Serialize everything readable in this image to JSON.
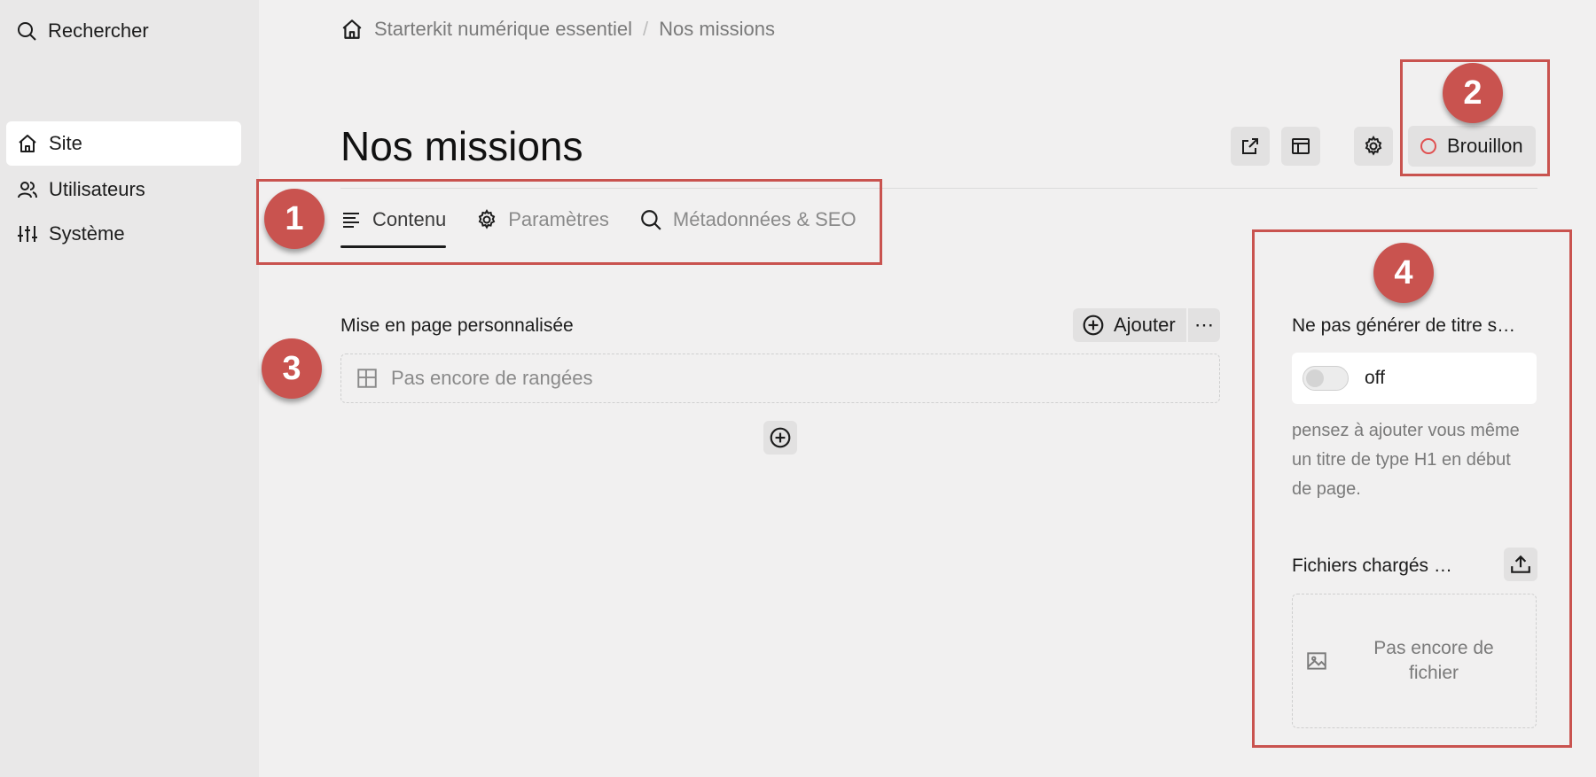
{
  "sidebar": {
    "search_label": "Rechercher",
    "items": [
      {
        "label": "Site",
        "icon": "home-icon",
        "active": true
      },
      {
        "label": "Utilisateurs",
        "icon": "users-icon",
        "active": false
      },
      {
        "label": "Système",
        "icon": "sliders-icon",
        "active": false
      }
    ]
  },
  "breadcrumb": {
    "root": "Starterkit numérique essentiel",
    "separator": "/",
    "current": "Nos missions"
  },
  "page": {
    "title": "Nos missions",
    "status": "Brouillon",
    "status_color": "#e05050"
  },
  "tabs": [
    {
      "label": "Contenu",
      "icon": "align-left-icon",
      "active": true
    },
    {
      "label": "Paramètres",
      "icon": "gear-icon",
      "active": false
    },
    {
      "label": "Métadonnées & SEO",
      "icon": "search-icon",
      "active": false
    }
  ],
  "layout": {
    "label": "Mise en page personnalisée",
    "add_label": "Ajouter",
    "more_label": "⋯",
    "empty_text": "Pas encore de rangées"
  },
  "side_panel": {
    "title_option_label": "Ne pas générer de titre s…",
    "toggle_state": "off",
    "help_text": "pensez à ajouter vous même un titre de type H1 en début de page.",
    "files_label": "Fichiers chargés …",
    "files_empty_text": "Pas encore de fichier"
  },
  "annotations": [
    "1",
    "2",
    "3",
    "4"
  ],
  "colors": {
    "annotation": "#c9534f",
    "sidebar_bg": "#e9e8e8",
    "page_bg": "#f1f0f0"
  }
}
